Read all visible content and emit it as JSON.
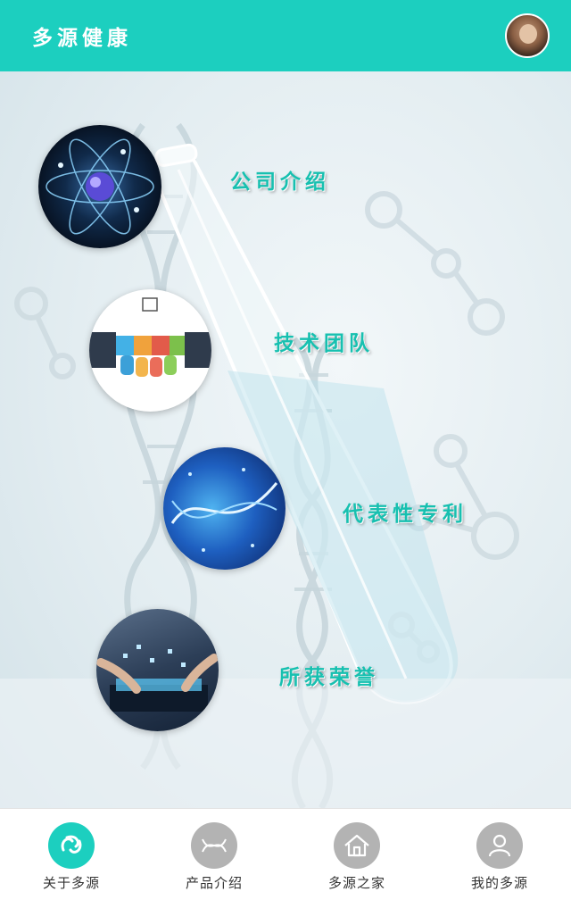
{
  "header": {
    "title": "多源健康",
    "avatar_icon": "user-avatar-icon"
  },
  "menu": {
    "items": [
      {
        "label": "公司介绍",
        "icon": "atom-icon"
      },
      {
        "label": "技术团队",
        "icon": "handshake-icon"
      },
      {
        "label": "代表性专利",
        "icon": "dna-icon"
      },
      {
        "label": "所获荣誉",
        "icon": "tablet-icon"
      }
    ]
  },
  "bottom_nav": {
    "items": [
      {
        "label": "关于多源",
        "icon": "about-icon",
        "active": true
      },
      {
        "label": "产品介绍",
        "icon": "product-icon",
        "active": false
      },
      {
        "label": "多源之家",
        "icon": "home-icon",
        "active": false
      },
      {
        "label": "我的多源",
        "icon": "profile-icon",
        "active": false
      }
    ]
  },
  "colors": {
    "accent": "#1ccfbf",
    "label": "#17c0b0",
    "inactive_icon": "#b3b3b3",
    "background": "#e9f1f4"
  }
}
